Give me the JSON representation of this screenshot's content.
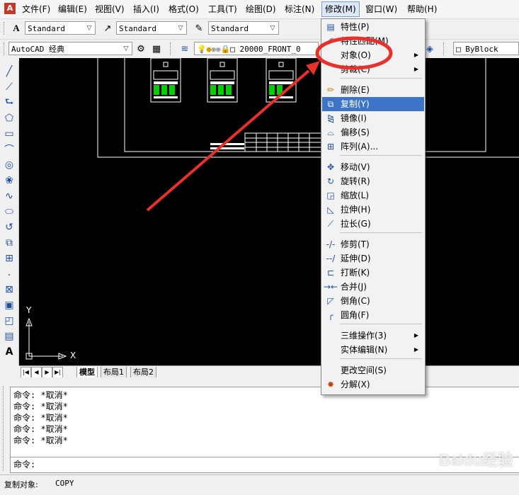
{
  "menubar": {
    "items": [
      {
        "label": "文件(F)"
      },
      {
        "label": "编辑(E)"
      },
      {
        "label": "视图(V)"
      },
      {
        "label": "插入(I)"
      },
      {
        "label": "格式(O)"
      },
      {
        "label": "工具(T)"
      },
      {
        "label": "绘图(D)"
      },
      {
        "label": "标注(N)"
      },
      {
        "label": "修改(M)"
      },
      {
        "label": "窗口(W)"
      },
      {
        "label": "帮助(H)"
      }
    ]
  },
  "styles_toolbar": {
    "text_style": "Standard",
    "dim_style": "Standard",
    "table_style": "Standard"
  },
  "workspace_toolbar": {
    "workspace": "AutoCAD 经典",
    "layer": "20000_FRONT_0",
    "color": "ByBlock"
  },
  "modify_menu": {
    "items": [
      {
        "label": "特性(P)",
        "icon": "properties-icon"
      },
      {
        "label": "特性匹配(M)",
        "icon": "match-properties-icon"
      },
      {
        "label": "对象(O)",
        "icon": "",
        "submenu": true
      },
      {
        "label": "剪裁(C)",
        "icon": "",
        "submenu": true
      },
      {
        "label": "删除(E)",
        "icon": "erase-icon"
      },
      {
        "label": "复制(Y)",
        "icon": "copy-icon",
        "highlighted": true
      },
      {
        "label": "镜像(I)",
        "icon": "mirror-icon"
      },
      {
        "label": "偏移(S)",
        "icon": "offset-icon"
      },
      {
        "label": "阵列(A)...",
        "icon": "array-icon"
      },
      {
        "label": "移动(V)",
        "icon": "move-icon"
      },
      {
        "label": "旋转(R)",
        "icon": "rotate-icon"
      },
      {
        "label": "缩放(L)",
        "icon": "scale-icon"
      },
      {
        "label": "拉伸(H)",
        "icon": "stretch-icon"
      },
      {
        "label": "拉长(G)",
        "icon": "lengthen-icon"
      },
      {
        "label": "修剪(T)",
        "icon": "trim-icon"
      },
      {
        "label": "延伸(D)",
        "icon": "extend-icon"
      },
      {
        "label": "打断(K)",
        "icon": "break-icon"
      },
      {
        "label": "合并(J)",
        "icon": "join-icon"
      },
      {
        "label": "倒角(C)",
        "icon": "chamfer-icon"
      },
      {
        "label": "圆角(F)",
        "icon": "fillet-icon"
      },
      {
        "label": "三维操作(3)",
        "icon": "",
        "submenu": true
      },
      {
        "label": "实体编辑(N)",
        "icon": "",
        "submenu": true
      },
      {
        "label": "更改空间(S)",
        "icon": ""
      },
      {
        "label": "分解(X)",
        "icon": "explode-icon"
      }
    ]
  },
  "tabs": {
    "model": "模型",
    "layout1": "布局1",
    "layout2": "布局2"
  },
  "ucs": {
    "x_label": "X",
    "y_label": "Y"
  },
  "command_history": [
    "命令: *取消*",
    "命令: *取消*",
    "命令: *取消*",
    "命令: *取消*",
    "命令: *取消*"
  ],
  "command_prompt": "命令:",
  "status": {
    "prompt": "复制对象:",
    "command": "COPY"
  },
  "watermark": "Baidu经验",
  "colors": {
    "canvas": "#000000",
    "menu_highlight": "#3d74c7",
    "annotation": "#e8312b",
    "drawing_green": "#00d000"
  }
}
